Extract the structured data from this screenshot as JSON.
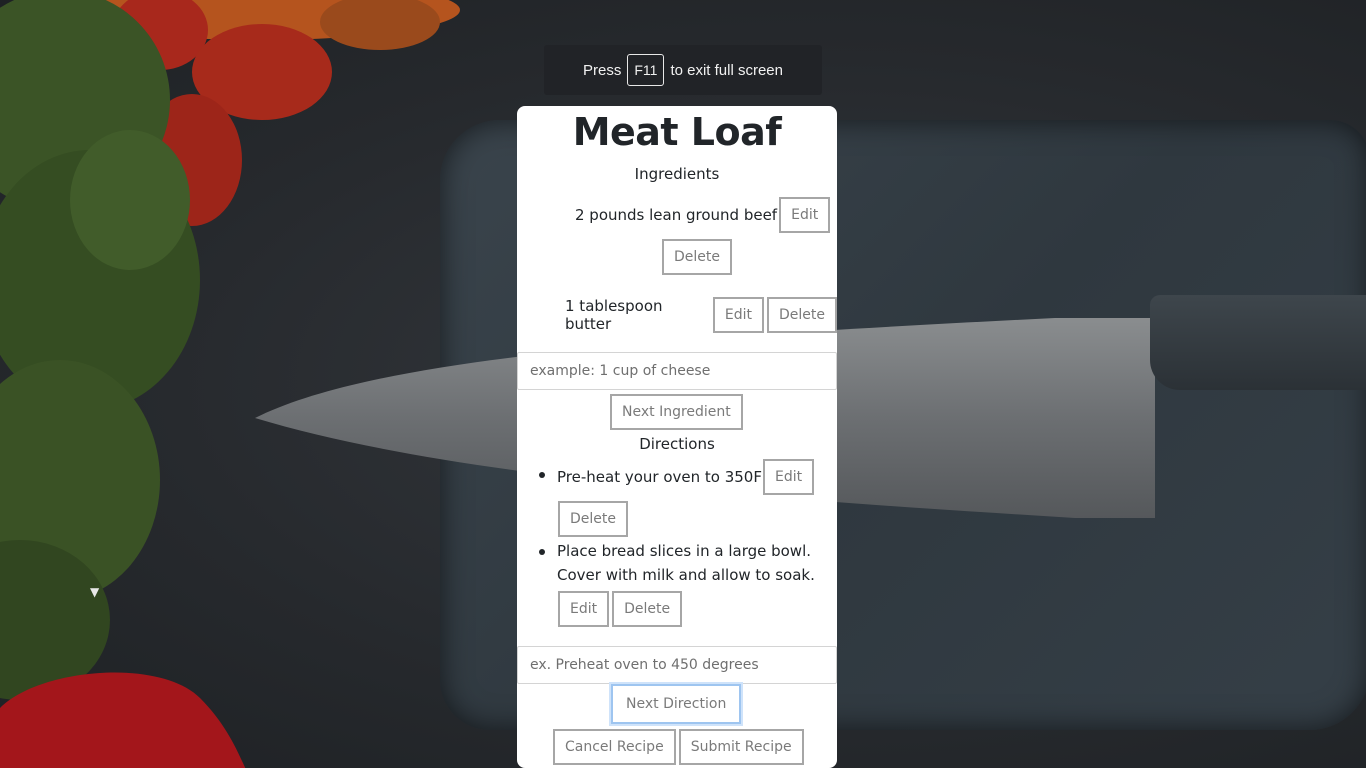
{
  "fullscreen_toast": {
    "prefix": "Press",
    "key": "F11",
    "suffix": "to exit full screen"
  },
  "recipe": {
    "title": "Meat Loaf",
    "ingredients_heading": "Ingredients",
    "ingredients": [
      {
        "text": "2 pounds lean ground beef",
        "edit_label": "Edit",
        "delete_label": "Delete"
      },
      {
        "text": "1 tablespoon butter",
        "edit_label": "Edit",
        "delete_label": "Delete"
      }
    ],
    "ingredient_input": {
      "placeholder": "example: 1 cup of cheese",
      "value": ""
    },
    "next_ingredient_label": "Next Ingredient",
    "directions_heading": "Directions",
    "directions": [
      {
        "text": "Pre-heat your oven to 350F",
        "edit_label": "Edit",
        "delete_label": "Delete"
      },
      {
        "line1": "Place bread slices in a large bowl.",
        "line2": "Cover with milk and allow to soak.",
        "edit_label": "Edit",
        "delete_label": "Delete"
      }
    ],
    "direction_input": {
      "placeholder": "ex. Preheat oven to 450 degrees",
      "value": ""
    },
    "next_direction_label": "Next Direction",
    "cancel_label": "Cancel Recipe",
    "submit_label": "Submit Recipe"
  },
  "background": {
    "description_icons": [
      "broccoli",
      "tomato",
      "carrot",
      "chef-knife",
      "slate-board",
      "red-pepper"
    ]
  }
}
